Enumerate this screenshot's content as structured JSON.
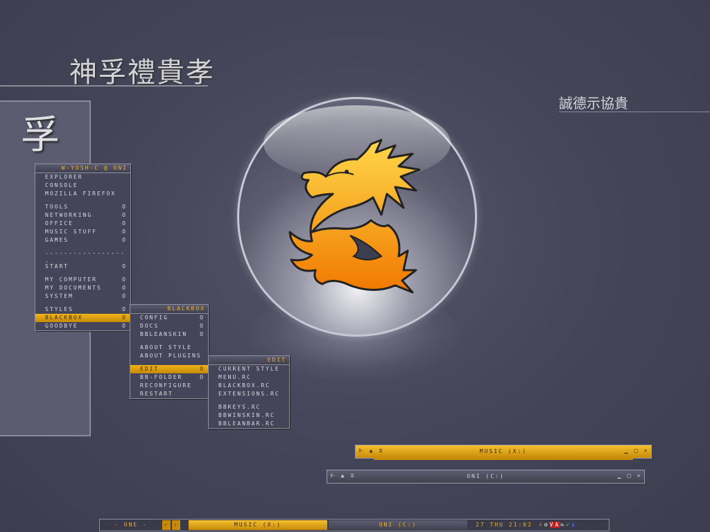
{
  "headings": {
    "main_kanji": "神孚禮貴孝",
    "side_kanji": "誠德示協貴",
    "panel_kanji": "孚"
  },
  "main_menu": {
    "title": "W-YOSH-C @ ONI",
    "items": [
      {
        "label": "EXPLORER",
        "arrow": ""
      },
      {
        "label": "CONSOLE",
        "arrow": ""
      },
      {
        "label": "MOZILLA FIREFOX",
        "arrow": ""
      },
      {
        "label": "TOOLS",
        "arrow": "o"
      },
      {
        "label": "NETWORKING",
        "arrow": "o"
      },
      {
        "label": "OFFICE",
        "arrow": "o"
      },
      {
        "label": "MUSIC STUFF",
        "arrow": "o"
      },
      {
        "label": "GAMES",
        "arrow": "o"
      },
      {
        "label": "------------------",
        "arrow": ""
      },
      {
        "label": "START",
        "arrow": "o"
      },
      {
        "label": "MY COMPUTER",
        "arrow": "o"
      },
      {
        "label": "MY DOCUMENTS",
        "arrow": "o"
      },
      {
        "label": "SYSTEM",
        "arrow": "o"
      },
      {
        "label": "STYLES",
        "arrow": "o"
      },
      {
        "label": "BLACKBOX",
        "arrow": "o"
      },
      {
        "label": "GOODBYE",
        "arrow": "o"
      }
    ]
  },
  "blackbox_menu": {
    "title": "BLACKBOX",
    "items": [
      {
        "label": "CONFIG",
        "arrow": "o"
      },
      {
        "label": "DOCS",
        "arrow": "o"
      },
      {
        "label": "BBLEANSKIN",
        "arrow": "o"
      },
      {
        "label": "ABOUT STYLE",
        "arrow": ""
      },
      {
        "label": "ABOUT PLUGINS",
        "arrow": ""
      },
      {
        "label": "EDIT",
        "arrow": "o"
      },
      {
        "label": "BB-FOLDER",
        "arrow": "o"
      },
      {
        "label": "RECONFIGURE",
        "arrow": ""
      },
      {
        "label": "RESTART",
        "arrow": ""
      }
    ]
  },
  "edit_menu": {
    "title": "EDIT",
    "items": [
      {
        "label": "CURRENT STYLE"
      },
      {
        "label": "MENU.RC"
      },
      {
        "label": "BLACKBOX.RC"
      },
      {
        "label": "EXTENSIONS.RC"
      },
      {
        "label": "BBKEYS.RC"
      },
      {
        "label": "BBWINSKIN.RC"
      },
      {
        "label": "BBLEANBAR.RC"
      }
    ]
  },
  "windows": {
    "music": {
      "title": "MUSIC (X:)"
    },
    "oni": {
      "title": "ONI (C:)"
    }
  },
  "taskbar": {
    "workspace": "- ONE -",
    "task_music": "MUSIC (X:)",
    "task_oni": "ONI (C:)",
    "clock": "27 THU 21:02"
  },
  "colors": {
    "accent": "#f0b020",
    "background": "#46465a",
    "menu_bg": "#45455a"
  }
}
